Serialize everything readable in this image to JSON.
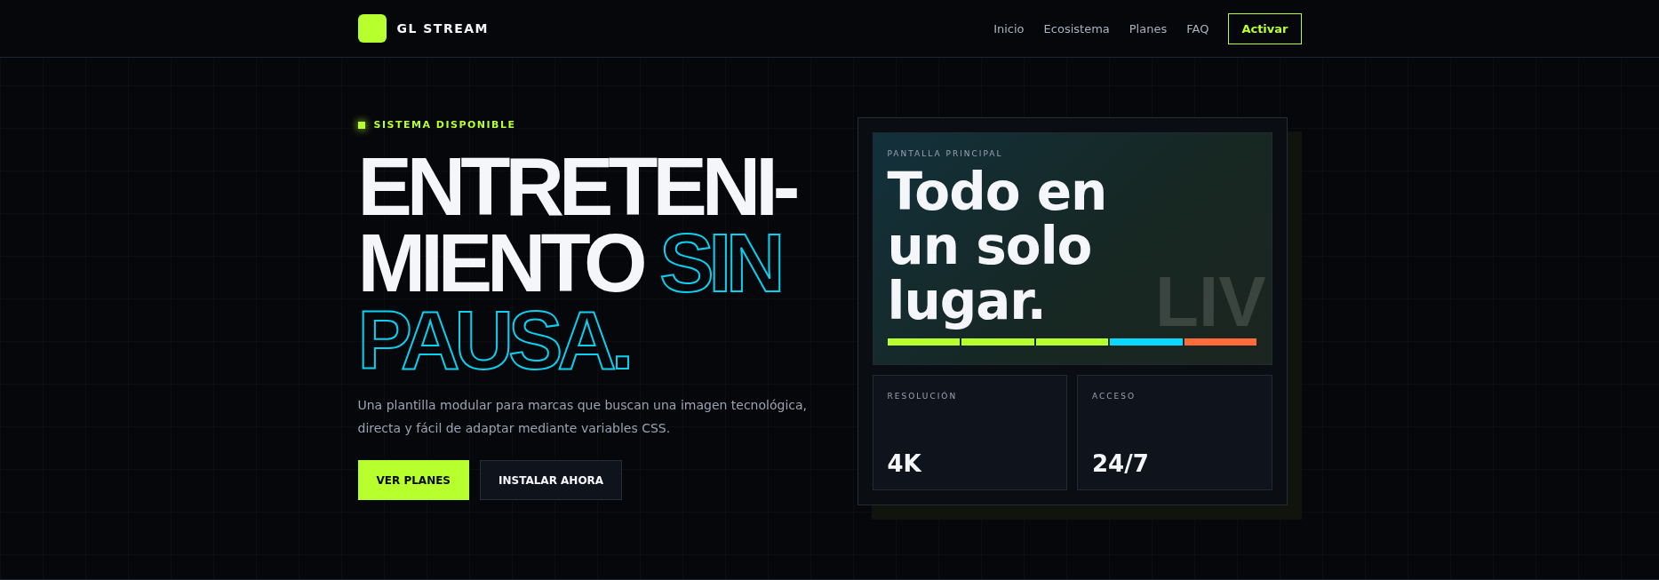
{
  "brand": {
    "name": "GL STREAM"
  },
  "nav": {
    "links": [
      "Inicio",
      "Ecosistema",
      "Planes",
      "FAQ"
    ],
    "cta": "Activar"
  },
  "hero": {
    "badge": "SISTEMA DISPONIBLE",
    "title_lines": [
      {
        "text": "ENTRETENI-",
        "kind": "solid"
      },
      {
        "text": "MIENTO",
        "kind": "solid"
      },
      {
        "text": "SIN",
        "kind": "outline"
      },
      {
        "text": "PAUSA.",
        "kind": "outline"
      }
    ],
    "description": "Una plantilla modular para marcas que buscan una imagen tecnológica, directa y fácil de adaptar mediante variables CSS.",
    "buttons": [
      {
        "label": "VER PLANES",
        "kind": "primary"
      },
      {
        "label": "INSTALAR AHORA",
        "kind": "secondary"
      }
    ]
  },
  "screen": {
    "label": "PANTALLA PRINCIPAL",
    "title": "Todo en un solo lugar.",
    "watermark": "LIV",
    "segments": [
      {
        "color": "#b8ff2e"
      },
      {
        "color": "#b8ff2e"
      },
      {
        "color": "#b8ff2e"
      },
      {
        "color": "#0ad8ff"
      },
      {
        "color": "#ff6b3a"
      }
    ]
  },
  "stats": [
    {
      "label": "RESOLUCIÓN",
      "value": "4K"
    },
    {
      "label": "ACCESO",
      "value": "24/7"
    }
  ]
}
